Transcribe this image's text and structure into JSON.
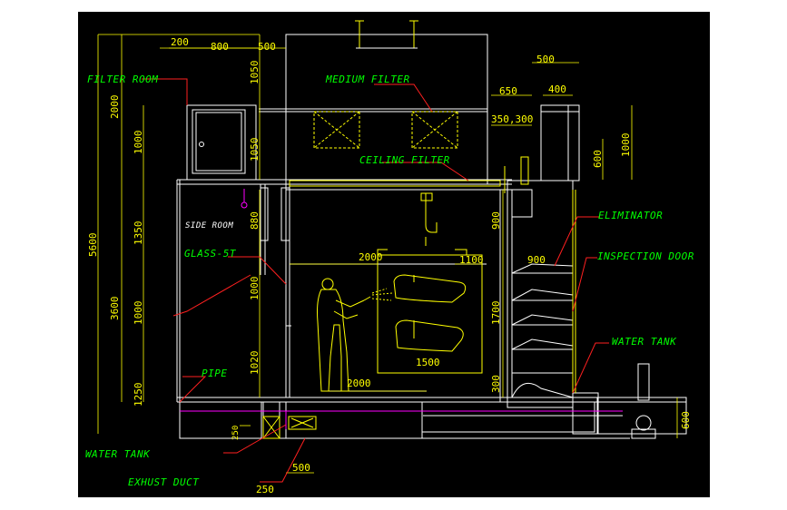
{
  "colors": {
    "background": "#000000",
    "outline": "#ffffff",
    "annotation": "#00ff00",
    "dimension": "#ffff00",
    "leader": "#ff2020",
    "accent": "#ff00ff"
  },
  "labels": {
    "filter_room": "FILTER ROOM",
    "medium_filter": "MEDIUM FILTER",
    "ceiling_filter": "CEILING FILTER",
    "eliminator": "ELIMINATOR",
    "inspection_door": "INSPECTION DOOR",
    "water_tank_right": "WATER TANK",
    "glass": "GLASS-5T",
    "pipe": "PIPE",
    "water_tank_left": "WATER TANK",
    "exhaust_duct": "EXHUST DUCT",
    "side_room": "SIDE ROOM"
  },
  "dimensions": {
    "d200": "200",
    "d800": "800",
    "d500_top": "500",
    "d1050_top": "1050",
    "d1050_mid": "1050",
    "d2000_left": "2000",
    "d1000_left": "1000",
    "d5600": "5600",
    "d1350": "1350",
    "d3600": "3600",
    "d1000_left2": "1000",
    "d1250": "1250",
    "d880": "880",
    "d1000_mid": "1000",
    "d1020": "1020",
    "d2000_mid": "2000",
    "d1100": "1100",
    "d900_vert": "900",
    "d1700": "1700",
    "d1500": "1500",
    "d2000_bottom": "2000",
    "d300": "300",
    "d500_right": "500",
    "d650": "650",
    "d400": "400",
    "d350_300": "350,300",
    "d1000_right": "1000",
    "d600_right": "600",
    "d900_horiz": "900",
    "d600_tank": "600",
    "d250_small": "250",
    "d500_bottom": "500",
    "d250_bottom": "250"
  }
}
